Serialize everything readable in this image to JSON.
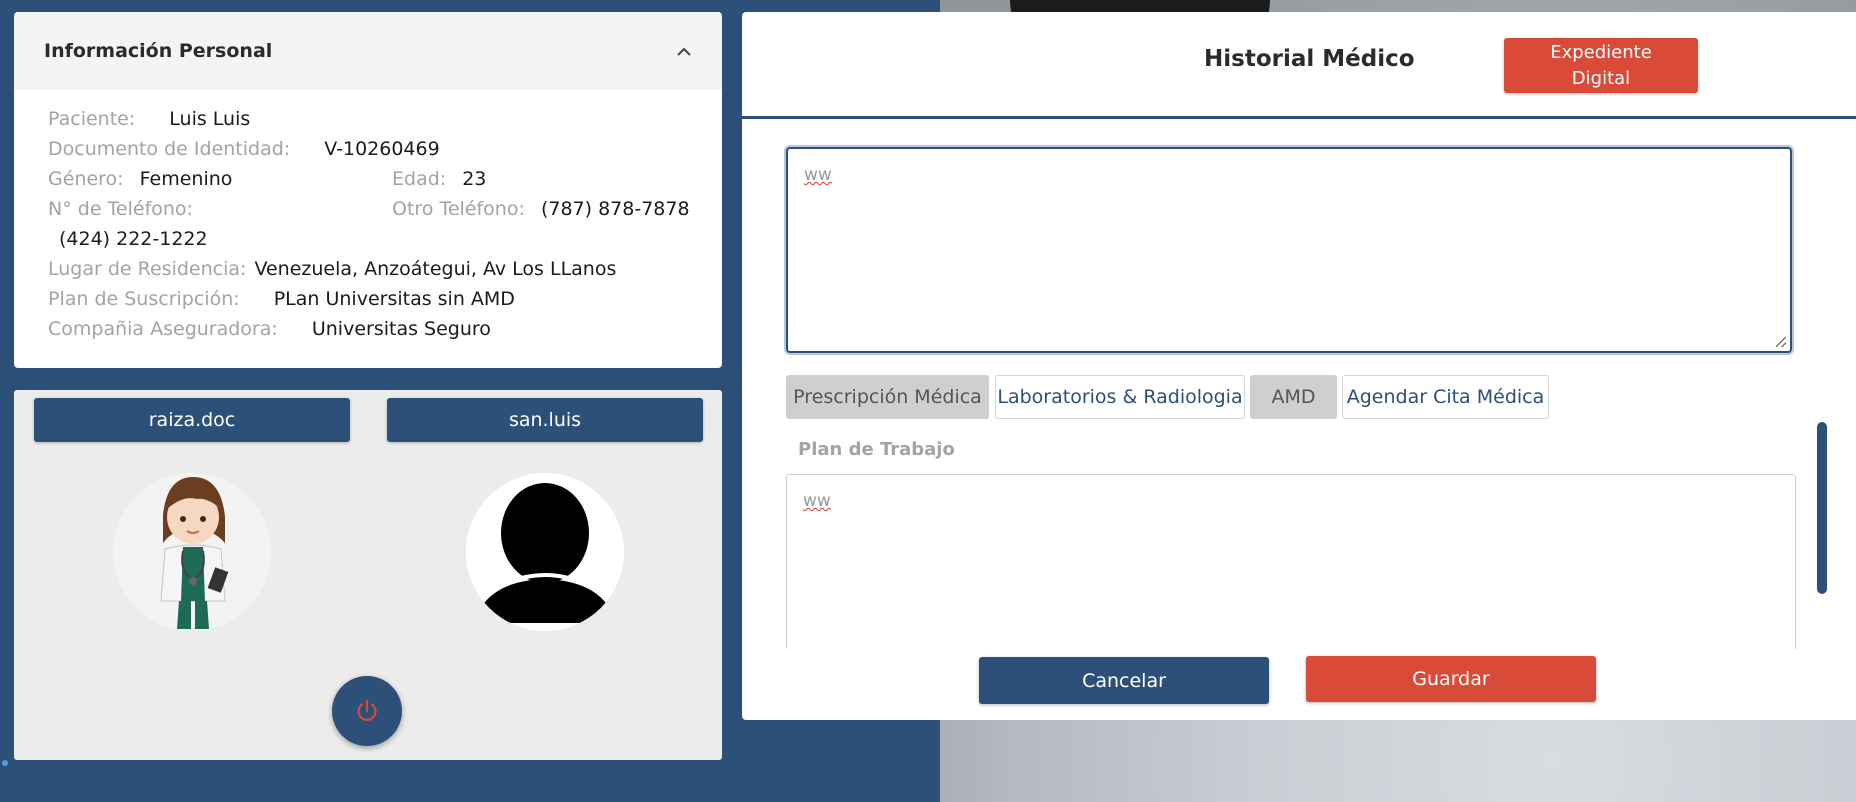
{
  "info": {
    "title": "Información Personal",
    "fields": {
      "patient_label": "Paciente:",
      "patient_value": "Luis Luis",
      "id_label": "Documento de Identidad:",
      "id_value": "V-10260469",
      "gender_label": "Género:",
      "gender_value": "Femenino",
      "age_label": "Edad:",
      "age_value": "23",
      "phone_label": "N° de Teléfono:",
      "phone_value": "(424) 222-1222",
      "other_phone_label": "Otro Teléfono:",
      "other_phone_value": "(787) 878-7878",
      "residence_label": "Lugar de Residencia:",
      "residence_value": "Venezuela, Anzoátegui, Av Los LLanos",
      "plan_label": "Plan de Suscripción:",
      "plan_value": "PLan Universitas sin AMD",
      "insurer_label": "Compañia Aseguradora:",
      "insurer_value": "Universitas Seguro"
    }
  },
  "users": {
    "doctor": "raiza.doc",
    "patient": "san.luis"
  },
  "modal": {
    "title": "Historial Médico",
    "expediente_button": "Expediente Digital",
    "textarea_top_value": "ww",
    "tabs": [
      "Prescripción Médica",
      "Laboratorios & Radiologia",
      "AMD",
      "Agendar Cita Médica"
    ],
    "plan_label": "Plan de Trabajo",
    "plan_value": "ww",
    "cancel_button": "Cancelar",
    "save_button": "Guardar"
  },
  "colors": {
    "primary": "#2c5077",
    "accent": "#d94a38"
  }
}
